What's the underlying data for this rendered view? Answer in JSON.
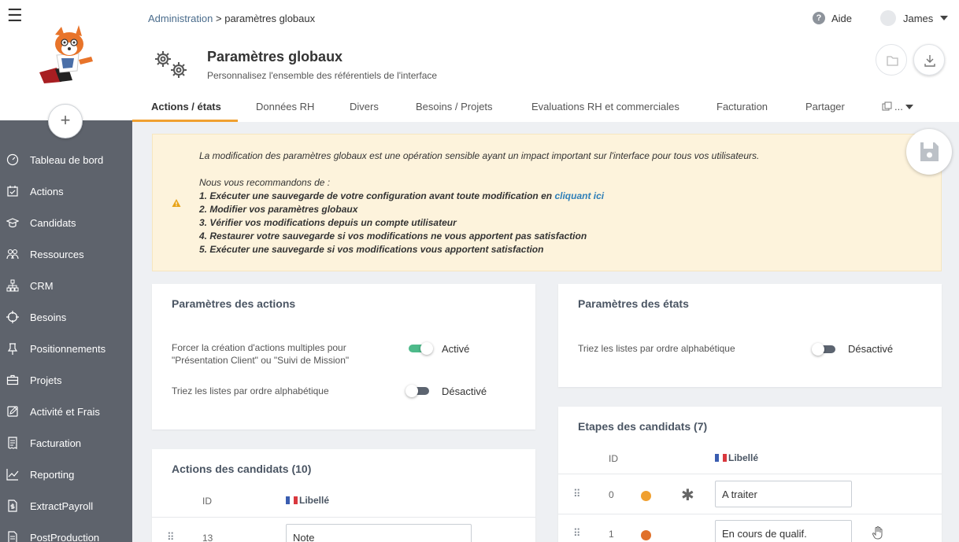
{
  "sidebar": {
    "items": [
      {
        "label": "Tableau de bord",
        "icon": "dashboard-icon"
      },
      {
        "label": "Actions",
        "icon": "calendar-check-icon"
      },
      {
        "label": "Candidats",
        "icon": "graduation-cap-icon"
      },
      {
        "label": "Ressources",
        "icon": "users-icon"
      },
      {
        "label": "CRM",
        "icon": "org-chart-icon"
      },
      {
        "label": "Besoins",
        "icon": "crosshair-icon"
      },
      {
        "label": "Positionnements",
        "icon": "pin-icon"
      },
      {
        "label": "Projets",
        "icon": "briefcase-icon"
      },
      {
        "label": "Activité et Frais",
        "icon": "edit-icon"
      },
      {
        "label": "Facturation",
        "icon": "invoice-icon"
      },
      {
        "label": "Reporting",
        "icon": "line-chart-icon"
      },
      {
        "label": "ExtractPayroll",
        "icon": "document-dollar-icon"
      },
      {
        "label": "PostProduction",
        "icon": "document-icon"
      }
    ]
  },
  "header": {
    "breadcrumb_root": "Administration",
    "breadcrumb_sep": ">",
    "breadcrumb_current": "paramètres globaux",
    "help_label": "Aide",
    "user_name": "James",
    "title": "Paramètres globaux",
    "subtitle": "Personnalisez l'ensemble des référentiels de l'interface"
  },
  "tabs": [
    "Actions / états",
    "Données RH",
    "Divers",
    "Besoins / Projets",
    "Evaluations RH et commerciales",
    "Facturation",
    "Partager"
  ],
  "tabs_more": "...",
  "warning": {
    "line1": "La modification des paramètres globaux est une opération sensible ayant un impact important sur l'interface pour tous vos utilisateurs.",
    "intro": "Nous vous recommandons de :",
    "step1": "1. Exécuter une sauvegarde de votre configuration avant toute modification en ",
    "step1_link": "cliquant ici",
    "step2": "2. Modifier vos paramètres globaux",
    "step3": "3. Vérifier vos modifications depuis un compte utilisateur",
    "step4": "4. Restaurer votre sauvegarde si vos modifications ne vous apportent pas satisfaction",
    "step5": "5. Exécuter une sauvegarde si vos modifications vous apportent satisfaction"
  },
  "actions_params": {
    "title": "Paramètres des actions",
    "setting1_line1": "Forcer la création d'actions multiples pour",
    "setting1_line2": "\"Présentation Client\" ou \"Suivi de Mission\"",
    "setting1_state": "Activé",
    "setting2_label": "Triez les listes par ordre alphabétique",
    "setting2_state": "Désactivé"
  },
  "states_params": {
    "title": "Paramètres des états",
    "setting1_label": "Triez les listes par ordre alphabétique",
    "setting1_state": "Désactivé"
  },
  "candidate_actions": {
    "title": "Actions des candidats (10)",
    "col_id": "ID",
    "col_label": "Libellé",
    "rows": [
      {
        "id": "13",
        "label": "Note"
      }
    ]
  },
  "candidate_steps": {
    "title": "Etapes des candidats (7)",
    "col_id": "ID",
    "col_label": "Libellé",
    "rows": [
      {
        "id": "0",
        "label": "A traiter",
        "color": "#f0a030"
      },
      {
        "id": "1",
        "label": "En cours de qualif.",
        "color": "#e0702a"
      }
    ]
  },
  "colors": {
    "accent": "#f0a030",
    "sidebar": "#5e636c",
    "toggle_on": "#4dba8a",
    "link": "#2e7fb8"
  }
}
